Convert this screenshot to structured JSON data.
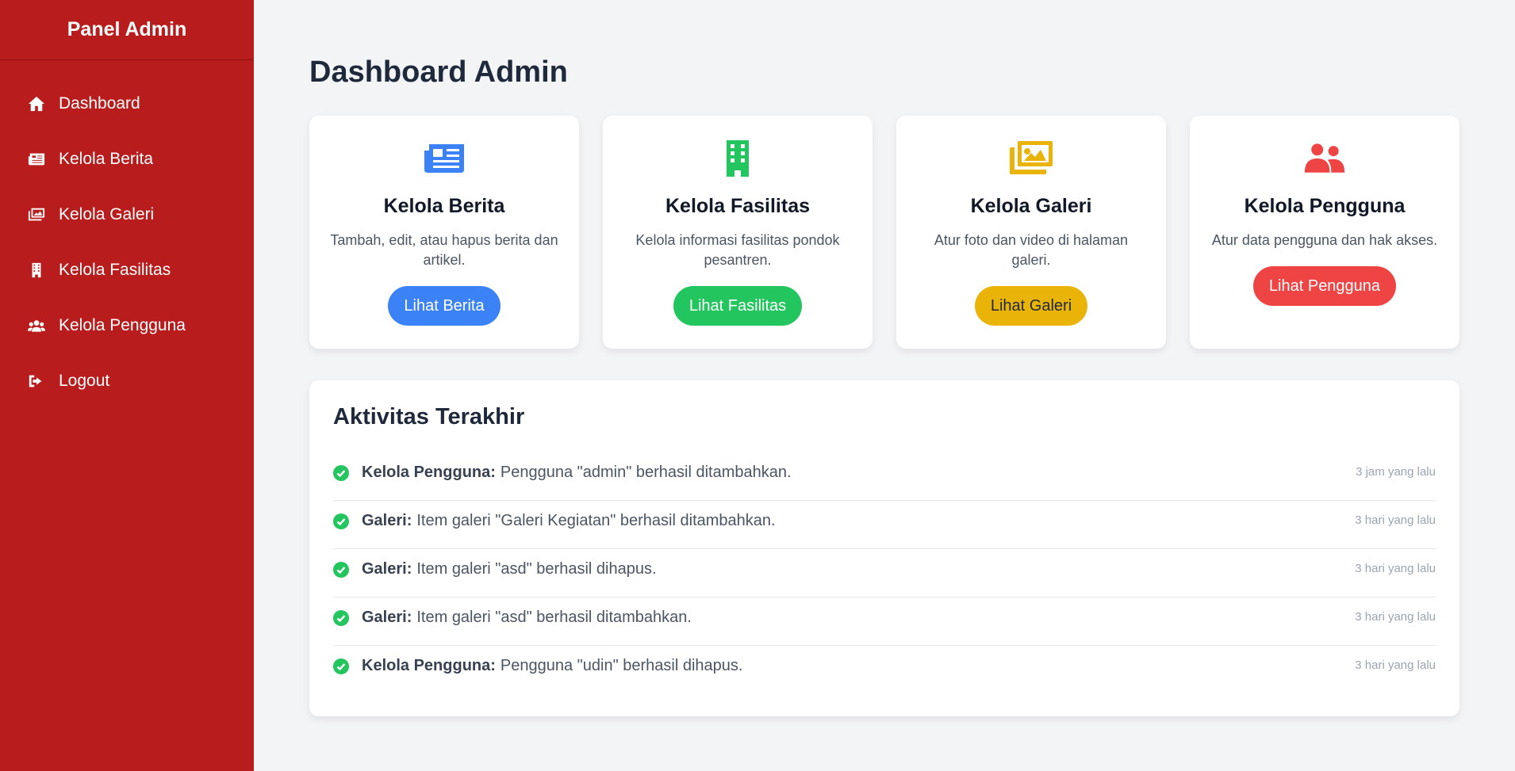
{
  "sidebar": {
    "brand": "Panel Admin",
    "items": [
      {
        "label": "Dashboard",
        "icon": "home-icon"
      },
      {
        "label": "Kelola Berita",
        "icon": "newspaper-icon"
      },
      {
        "label": "Kelola Galeri",
        "icon": "images-icon"
      },
      {
        "label": "Kelola Fasilitas",
        "icon": "building-icon"
      },
      {
        "label": "Kelola Pengguna",
        "icon": "users-icon"
      },
      {
        "label": "Logout",
        "icon": "logout-icon"
      }
    ]
  },
  "page": {
    "title": "Dashboard Admin"
  },
  "cards": [
    {
      "title": "Kelola Berita",
      "desc": "Tambah, edit, atau hapus berita dan artikel.",
      "button": "Lihat Berita",
      "icon": "newspaper-icon",
      "color": "#3b82f6"
    },
    {
      "title": "Kelola Fasilitas",
      "desc": "Kelola informasi fasilitas pondok pesantren.",
      "button": "Lihat Fasilitas",
      "icon": "building-icon",
      "color": "#22c55e"
    },
    {
      "title": "Kelola Galeri",
      "desc": "Atur foto dan video di halaman galeri.",
      "button": "Lihat Galeri",
      "icon": "images-icon",
      "color": "#eab308"
    },
    {
      "title": "Kelola Pengguna",
      "desc": "Atur data pengguna dan hak akses.",
      "button": "Lihat Pengguna",
      "icon": "users-icon",
      "color": "#ef4444"
    }
  ],
  "activity": {
    "title": "Aktivitas Terakhir",
    "items": [
      {
        "category": "Kelola Pengguna:",
        "text": "Pengguna \"admin\" berhasil ditambahkan.",
        "time": "3 jam yang lalu"
      },
      {
        "category": "Galeri:",
        "text": "Item galeri \"Galeri Kegiatan\" berhasil ditambahkan.",
        "time": "3 hari yang lalu"
      },
      {
        "category": "Galeri:",
        "text": "Item galeri \"asd\" berhasil dihapus.",
        "time": "3 hari yang lalu"
      },
      {
        "category": "Galeri:",
        "text": "Item galeri \"asd\" berhasil ditambahkan.",
        "time": "3 hari yang lalu"
      },
      {
        "category": "Kelola Pengguna:",
        "text": "Pengguna \"udin\" berhasil dihapus.",
        "time": "3 hari yang lalu"
      }
    ]
  },
  "colors": {
    "sidebar_bg": "#b91c1c",
    "success": "#22c55e"
  }
}
